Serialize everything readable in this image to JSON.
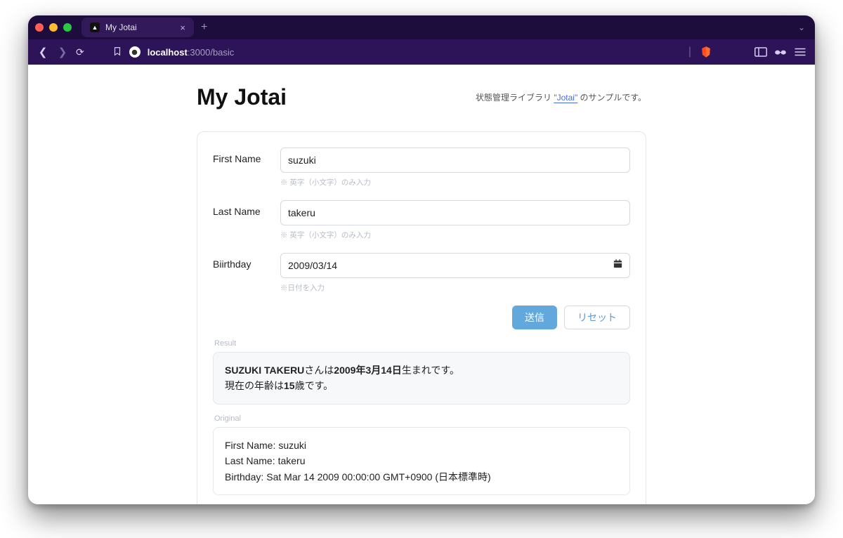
{
  "browser": {
    "tab_title": "My Jotai",
    "url_host": "localhost",
    "url_path": ":3000/basic"
  },
  "page": {
    "title": "My Jotai",
    "desc_prefix": "状態管理ライブラリ ",
    "desc_link": "\"Jotai\"",
    "desc_suffix": " のサンプルです。"
  },
  "form": {
    "first_name": {
      "label": "First Name",
      "value": "suzuki",
      "hint": "※ 英字（小文字）のみ入力"
    },
    "last_name": {
      "label": "Last Name",
      "value": "takeru",
      "hint": "※ 英字（小文字）のみ入力"
    },
    "birthday": {
      "label": "Biirthday",
      "value": "2009/03/14",
      "hint": "※日付を入力"
    },
    "submit_label": "送信",
    "reset_label": "リセット"
  },
  "result": {
    "section_label": "Result",
    "name_strong": "SUZUKI TAKERU",
    "line1_mid": "さんは",
    "date_strong": "2009年3月14日",
    "line1_end": "生まれです。",
    "line2_pre": "現在の年齢は",
    "age_strong": "15",
    "line2_end": "歳です。"
  },
  "original": {
    "section_label": "Original",
    "first_label": "First Name: ",
    "first_value": "suzuki",
    "last_label": "Last Name: ",
    "last_value": "takeru",
    "bday_label": "Birthday: ",
    "bday_value": "Sat Mar 14 2009 00:00:00 GMT+0900 (日本標準時)"
  }
}
